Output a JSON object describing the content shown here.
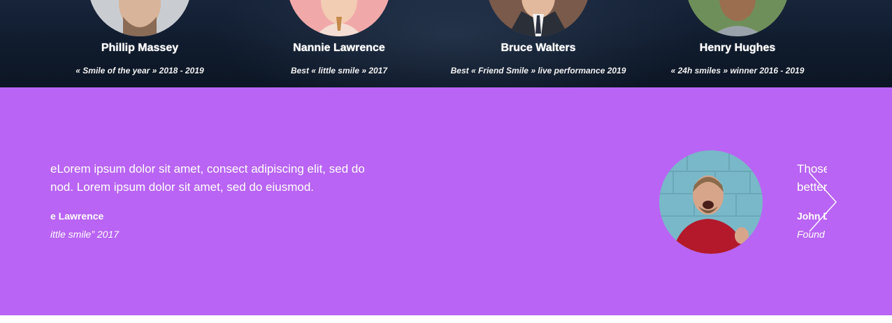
{
  "team": {
    "members": [
      {
        "name": "Phillip Massey",
        "award": "« Smile of the year » 2018 - 2019"
      },
      {
        "name": "Nannie Lawrence",
        "award": "Best « little smile » 2017"
      },
      {
        "name": "Bruce Walters",
        "award": "Best « Friend Smile » live performance 2019"
      },
      {
        "name": "Henry Hughes",
        "award": "« 24h smiles » winner 2016 - 2019"
      }
    ]
  },
  "testimonials": {
    "previous": {
      "quote_line1": "eLorem ipsum dolor sit amet, consect adipiscing elit, sed do",
      "quote_line2": "nod. Lorem ipsum dolor sit amet, sed do eiusmod.",
      "author": "e Lawrence",
      "role": "ittle smile” 2017"
    },
    "next": {
      "quote_line1": "Those",
      "quote_line2": "better",
      "author": "John D",
      "role": "Found"
    },
    "next_arrow_icon": "chevron-right-icon"
  },
  "colors": {
    "team_bg": "#0f1a2b",
    "testimonials_bg": "#b964f4",
    "text": "#ffffff"
  }
}
